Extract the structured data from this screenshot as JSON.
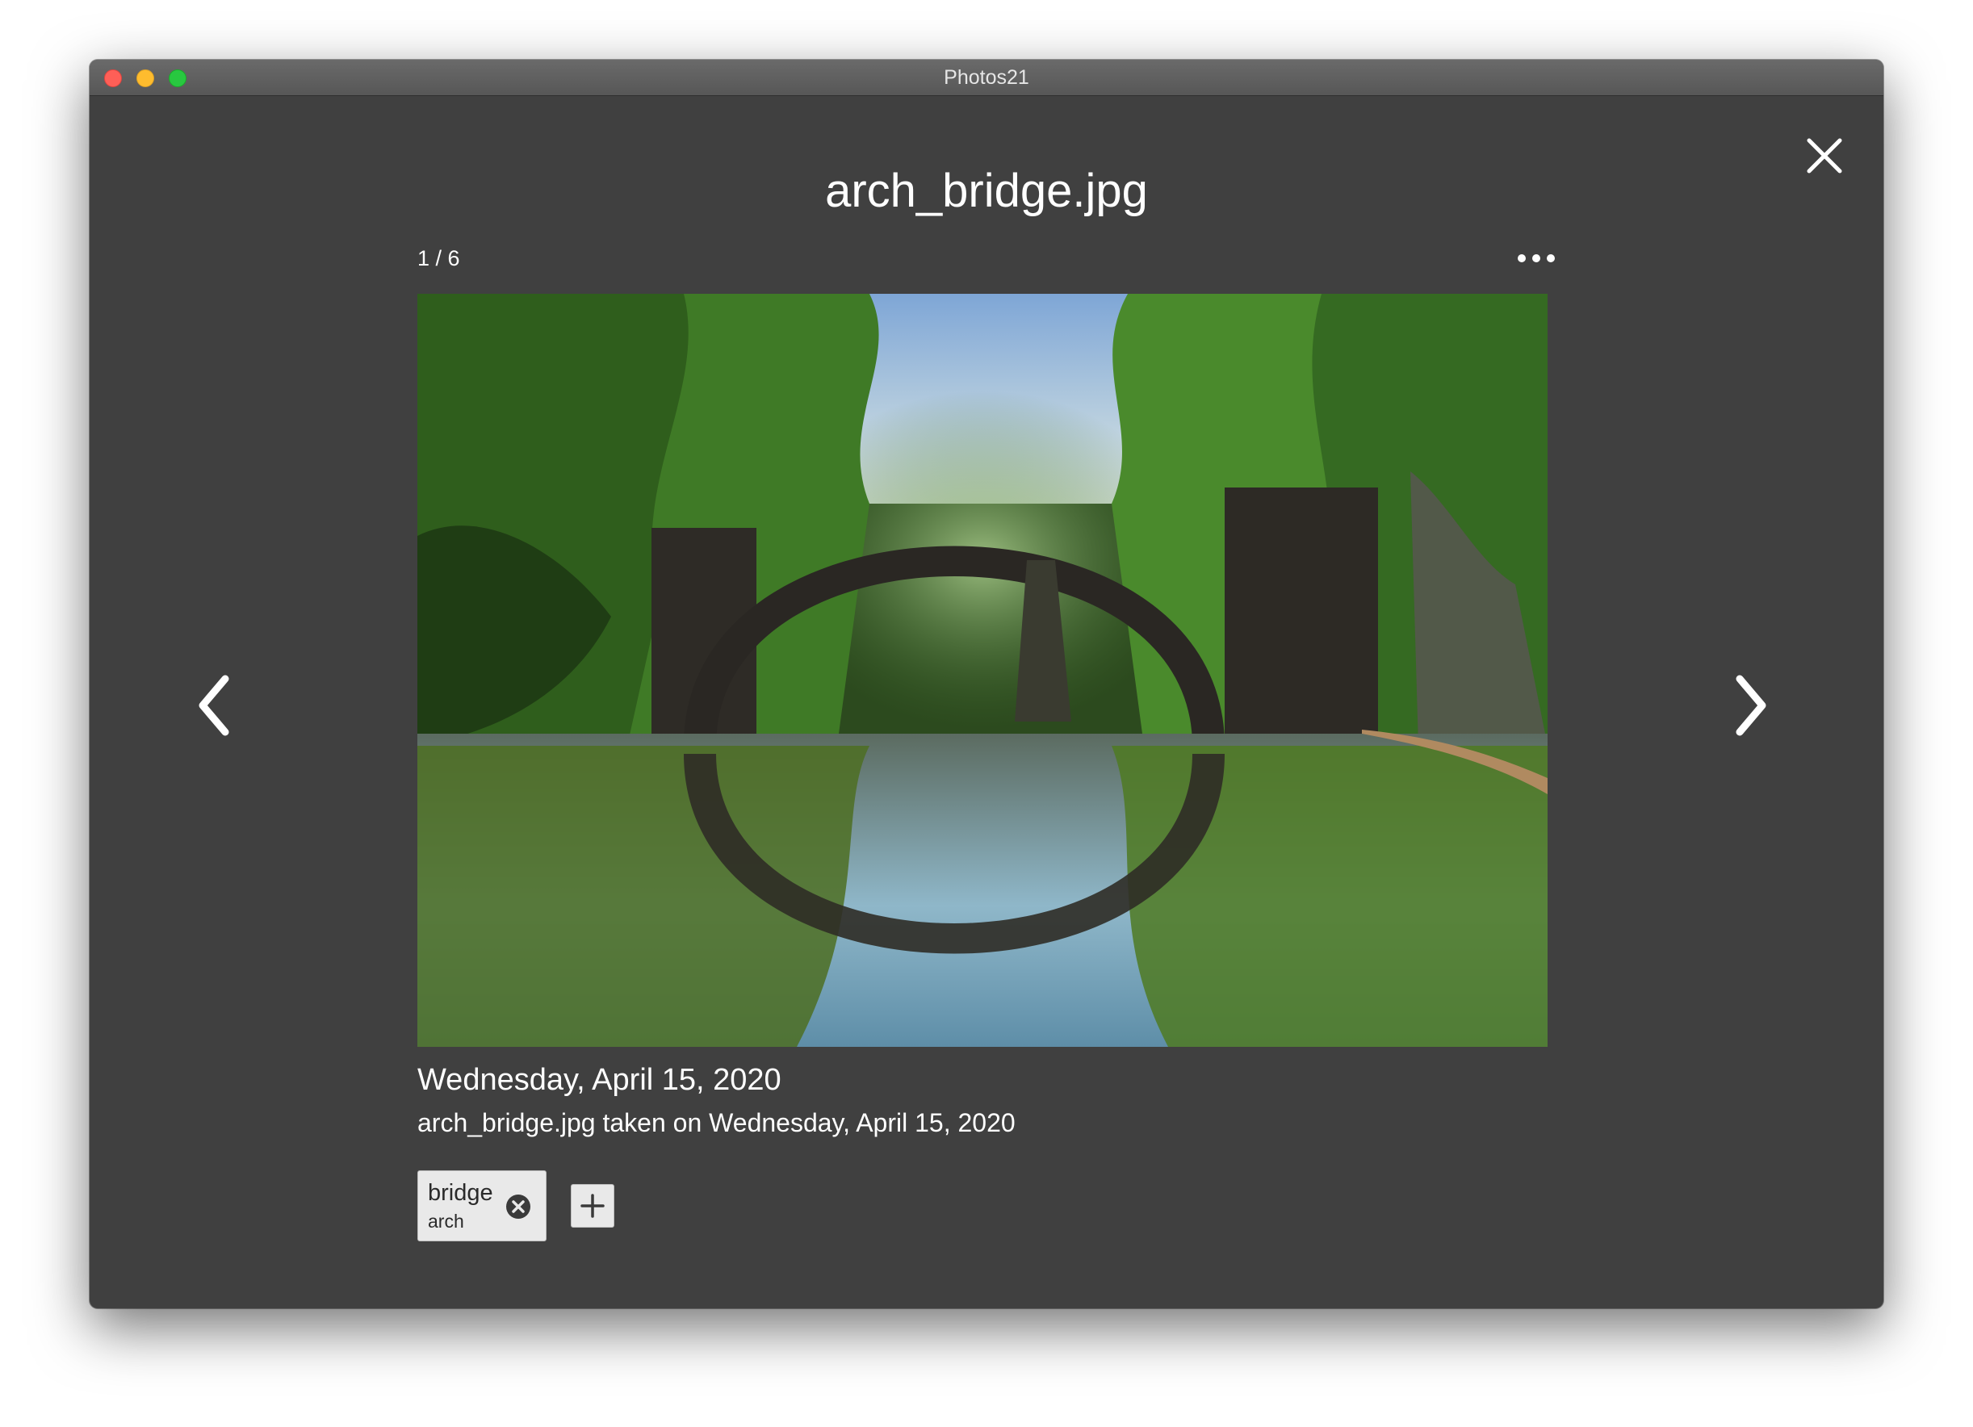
{
  "window": {
    "title": "Photos21"
  },
  "viewer": {
    "filename": "arch_bridge.jpg",
    "counter": "1 / 6",
    "date": "Wednesday, April 15, 2020",
    "caption": "arch_bridge.jpg taken on Wednesday, April 15, 2020"
  },
  "tags": [
    {
      "label": "bridge",
      "sublabel": "arch"
    }
  ],
  "icons": {
    "close": "close-icon",
    "more": "more-options-icon",
    "prev": "chevron-left-icon",
    "next": "chevron-right-icon",
    "tag_remove": "remove-tag-icon",
    "add_tag": "plus-icon"
  },
  "colors": {
    "window_background": "#404040",
    "titlebar": "#5f5f5f",
    "text": "#ffffff",
    "chip_background": "#e9e9e9"
  }
}
